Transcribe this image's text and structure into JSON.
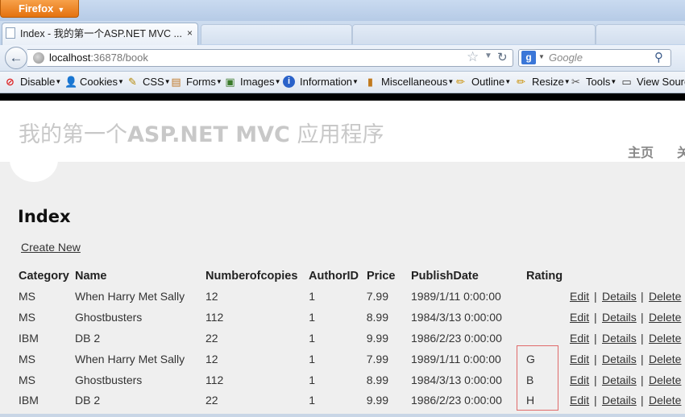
{
  "browser": {
    "menu_button": "Firefox",
    "tab_title": "Index - 我的第一个ASP.NET MVC ...",
    "tab_close": "×",
    "url_host": "localhost",
    "url_rest": ":36878/book",
    "search_placeholder": "Google",
    "toolbar": {
      "disable": "Disable",
      "cookies": "Cookies",
      "css": "CSS",
      "forms": "Forms",
      "images": "Images",
      "information": "Information",
      "miscellaneous": "Miscellaneous",
      "outline": "Outline",
      "resize": "Resize",
      "tools": "Tools",
      "view_source": "View Sourc"
    }
  },
  "page": {
    "site_title_cn1": "我的第一个",
    "site_title_en": "ASP.NET MVC",
    "site_title_cn2": " 应用程序",
    "menu_home": "主页",
    "menu_about": "关",
    "heading": "Index",
    "create_new": "Create New",
    "columns": [
      "Category",
      "Name",
      "Numberofcopies",
      "AuthorID",
      "Price",
      "PublishDate",
      "Rating"
    ],
    "rows": [
      {
        "category": "MS",
        "name": "When Harry Met Sally",
        "copies": "12",
        "author": "1",
        "price": "7.99",
        "date": "1989/1/11 0:00:00",
        "rating": ""
      },
      {
        "category": "MS",
        "name": "Ghostbusters",
        "copies": "112",
        "author": "1",
        "price": "8.99",
        "date": "1984/3/13 0:00:00",
        "rating": ""
      },
      {
        "category": "IBM",
        "name": "DB 2",
        "copies": "22",
        "author": "1",
        "price": "9.99",
        "date": "1986/2/23 0:00:00",
        "rating": ""
      },
      {
        "category": "MS",
        "name": "When Harry Met Sally",
        "copies": "12",
        "author": "1",
        "price": "7.99",
        "date": "1989/1/11 0:00:00",
        "rating": "G"
      },
      {
        "category": "MS",
        "name": "Ghostbusters",
        "copies": "112",
        "author": "1",
        "price": "8.99",
        "date": "1984/3/13 0:00:00",
        "rating": "B"
      },
      {
        "category": "IBM",
        "name": "DB 2",
        "copies": "22",
        "author": "1",
        "price": "9.99",
        "date": "1986/2/23 0:00:00",
        "rating": "H"
      }
    ],
    "actions": {
      "edit": "Edit",
      "details": "Details",
      "delete": "Delete",
      "separator": "|"
    }
  },
  "colors": {
    "rating_highlight": "#e06a6a",
    "firefox_button": "#e4720f"
  }
}
